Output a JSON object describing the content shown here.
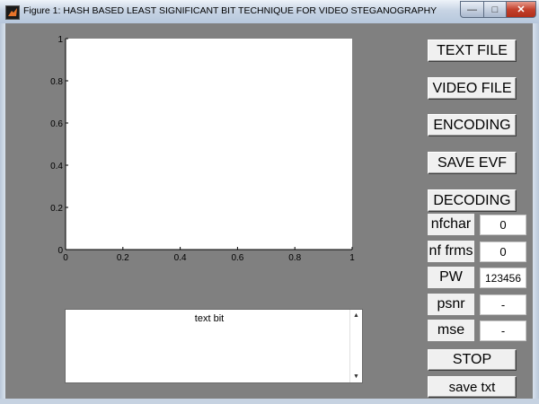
{
  "window": {
    "title": "Figure 1: HASH BASED LEAST SIGNIFICANT BIT TECHNIQUE FOR VIDEO STEGANOGRAPHY",
    "minimize_glyph": "—",
    "maximize_glyph": "□",
    "close_glyph": "✕"
  },
  "axes": {
    "x_ticks": [
      "0",
      "0.2",
      "0.4",
      "0.6",
      "0.8",
      "1"
    ],
    "y_ticks": [
      "0",
      "0.2",
      "0.4",
      "0.6",
      "0.8",
      "1"
    ],
    "xlim": [
      0,
      1
    ],
    "ylim": [
      0,
      1
    ]
  },
  "text_panel": {
    "content": "text bit",
    "scroll_up_glyph": "▲",
    "scroll_down_glyph": "▼"
  },
  "buttons": {
    "text_file": "TEXT FILE",
    "video_file": "VIDEO FILE",
    "encoding": "ENCODING",
    "save_evf": "SAVE EVF",
    "decoding": "DECODING",
    "stop": "STOP",
    "save_txt": "save txt"
  },
  "fields": {
    "nfchar": {
      "label": "nfchar",
      "value": "0"
    },
    "nf_frms": {
      "label": "nf frms",
      "value": "0"
    },
    "pw": {
      "label": "PW",
      "value": "123456"
    },
    "psnr": {
      "label": "psnr",
      "value": "-"
    },
    "mse": {
      "label": "mse",
      "value": "-"
    }
  }
}
